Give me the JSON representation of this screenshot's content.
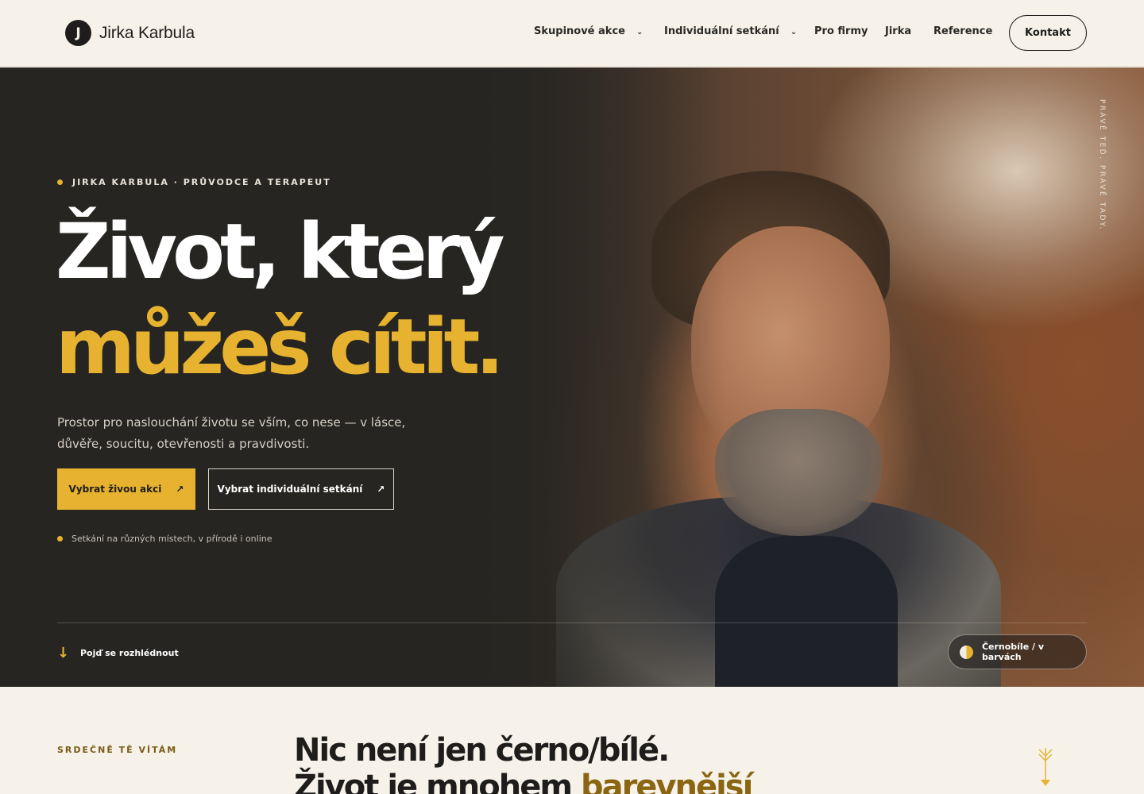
{
  "header": {
    "logo_letter": "J",
    "logo_text": "Jirka Karbula",
    "nav": [
      {
        "label": "Skupinové akce",
        "has_dropdown": true
      },
      {
        "label": "Individuální setkání",
        "has_dropdown": true
      },
      {
        "label": "Pro firmy",
        "has_dropdown": false
      },
      {
        "label": "Jirka",
        "has_dropdown": false
      },
      {
        "label": "Reference",
        "has_dropdown": false
      }
    ],
    "contact_label": "Kontakt"
  },
  "hero": {
    "eyebrow": "JIRKA KARBULA · PRŮVODCE A TERAPEUT",
    "headline_line1": "Život, který",
    "headline_line2": "můžeš cítit.",
    "lead": "Prostor pro naslouchání životu se vším, co nese — v lásce, důvěře, soucitu, otevřenosti a pravdivosti.",
    "primary_cta": "Vybrat živou akci",
    "secondary_cta": "Vybrat individuální setkání",
    "cta_arrow": "↗",
    "note": "Setkání na různých místech, v přírodě i online",
    "scroll_cue": "Pojď se rozhlédnout",
    "scroll_arrow": "↓",
    "toggle_label": "Černobíle / v barvách",
    "vertical_text": "PRÁVĚ TEĎ. PRÁVĚ TADY."
  },
  "welcome": {
    "label": "SRDEČNĚ TĚ VÍTÁM",
    "title_line1": "Nic není jen černo/bílé.",
    "title_line2_start": "Život je mnohem ",
    "title_line2_highlight": "barevnější"
  },
  "colors": {
    "accent": "#e6b22f",
    "dark": "#262522",
    "cream": "#f6f2ea",
    "highlight_text": "#8a6612"
  }
}
